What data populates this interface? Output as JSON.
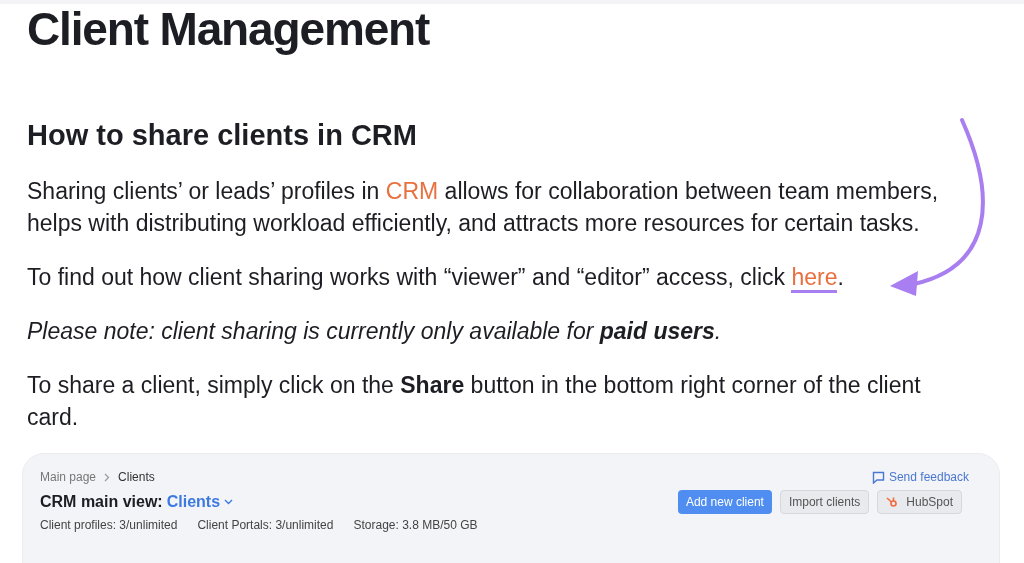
{
  "page_title": "Client Management",
  "section_title": "How to share clients in CRM",
  "paragraphs": [
    {
      "kind": "link",
      "before": "Sharing clients’ or leads’ profiles in ",
      "link": "CRM",
      "after": " allows for collaboration between team members, helps with distributing workload efficiently, and attracts more resources for certain tasks."
    },
    {
      "kind": "link",
      "before": "To find out how client sharing works with “viewer” and “editor” access, click ",
      "link": "here",
      "after": "."
    },
    {
      "kind": "note",
      "text": "Please note: client sharing is currently only available for **paid users**."
    },
    {
      "kind": "plain",
      "text": "To share a client, simply click on the **Share** button in the bottom right corner of the client card."
    }
  ],
  "crm": {
    "breadcrumbs": [
      "Main page",
      "Clients"
    ],
    "feedback": "Send feedback",
    "view_label": "CRM main view:",
    "view_value": "Clients",
    "buttons": [
      {
        "kind": "primary",
        "label": "Add new client"
      },
      {
        "kind": "secondary",
        "label": "Import clients"
      },
      {
        "kind": "hubspot",
        "label": "HubSpot"
      }
    ],
    "stats": [
      "Client profiles: 3/unlimited",
      "Client Portals: 3/unlimited",
      "Storage: 3.8 MB/50 GB"
    ]
  }
}
